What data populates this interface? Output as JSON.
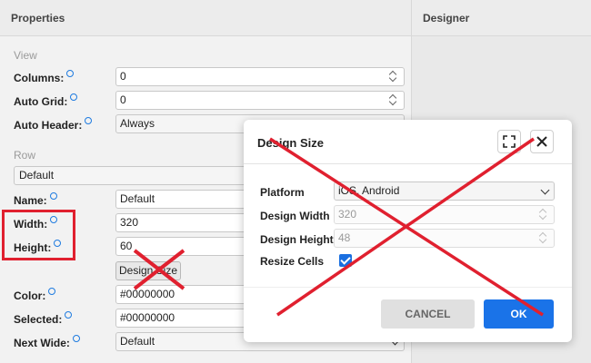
{
  "properties_panel": {
    "title": "Properties",
    "section_view": "View",
    "section_row": "Row",
    "columns": {
      "label": "Columns:",
      "value": "0"
    },
    "auto_grid": {
      "label": "Auto Grid:",
      "value": "0"
    },
    "auto_header": {
      "label": "Auto Header:",
      "value": "Always"
    },
    "row_select": "Default",
    "name": {
      "label": "Name:",
      "value": "Default"
    },
    "width": {
      "label": "Width:",
      "value": "320"
    },
    "height": {
      "label": "Height:",
      "value": "60"
    },
    "design_size_button": "Design Size",
    "color": {
      "label": "Color:",
      "value": "#00000000"
    },
    "selected": {
      "label": "Selected:",
      "value": "#00000000"
    },
    "next_wide": {
      "label": "Next Wide:",
      "value": "Default"
    }
  },
  "designer_panel": {
    "title": "Designer"
  },
  "dialog": {
    "title": "Design Size",
    "platform": {
      "label": "Platform",
      "value": "iOS, Android"
    },
    "design_width": {
      "label": "Design Width",
      "value": "320"
    },
    "design_height": {
      "label": "Design Height",
      "value": "48"
    },
    "resize_cells": {
      "label": "Resize Cells",
      "checked": true
    },
    "cancel_label": "CANCEL",
    "ok_label": "OK"
  },
  "annotations": {
    "color": "#e0202f"
  },
  "colors": {
    "accent": "#1a73e8",
    "annotation_red": "#e0202f"
  }
}
